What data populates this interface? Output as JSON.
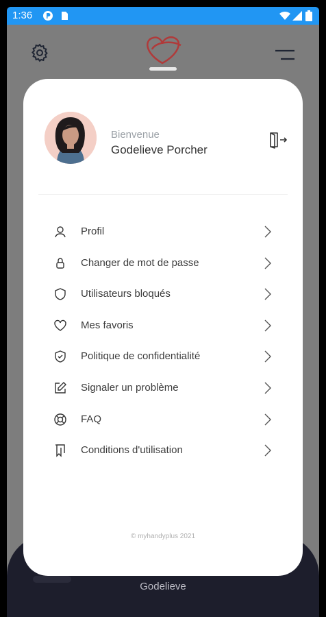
{
  "status_bar": {
    "time": "1:36"
  },
  "sheet": {
    "welcome": "Bienvenue",
    "user_name": "Godelieve Porcher",
    "menu": [
      {
        "label": "Profil",
        "icon": "user-icon"
      },
      {
        "label": "Changer de mot de passe",
        "icon": "lock-icon"
      },
      {
        "label": "Utilisateurs bloqués",
        "icon": "shield-icon"
      },
      {
        "label": "Mes favoris",
        "icon": "heart-icon"
      },
      {
        "label": "Politique de confidentialité",
        "icon": "shield-check-icon"
      },
      {
        "label": "Signaler un problème",
        "icon": "edit-icon"
      },
      {
        "label": "FAQ",
        "icon": "lifebuoy-icon"
      },
      {
        "label": "Conditions d'utilisation",
        "icon": "scroll-icon"
      }
    ],
    "copyright": "© myhandyplus 2021"
  },
  "bottom_bar": {
    "name": "Godelieve"
  },
  "colors": {
    "status_bar": "#2196f3",
    "scrim": "#7d7d7d",
    "bottom_bar": "#1d1e2c",
    "logo": "#b03a3a"
  }
}
